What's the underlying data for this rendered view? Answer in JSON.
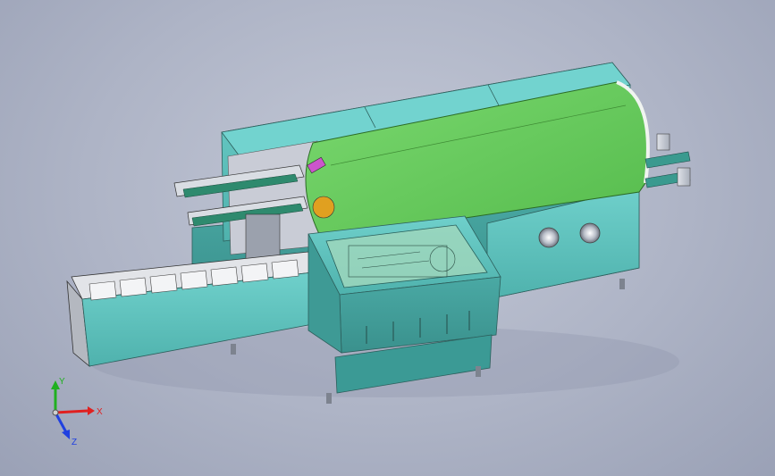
{
  "view": {
    "background_color": "#aeb4c6"
  },
  "triad": {
    "x_label": "X",
    "y_label": "Y",
    "z_label": "Z",
    "x_color": "#e02020",
    "y_color": "#20b020",
    "z_color": "#2040e0"
  },
  "model": {
    "body_color": "#5fc4bf",
    "cover_color": "#66cc5e",
    "panel_color": "#c8ccd4"
  }
}
